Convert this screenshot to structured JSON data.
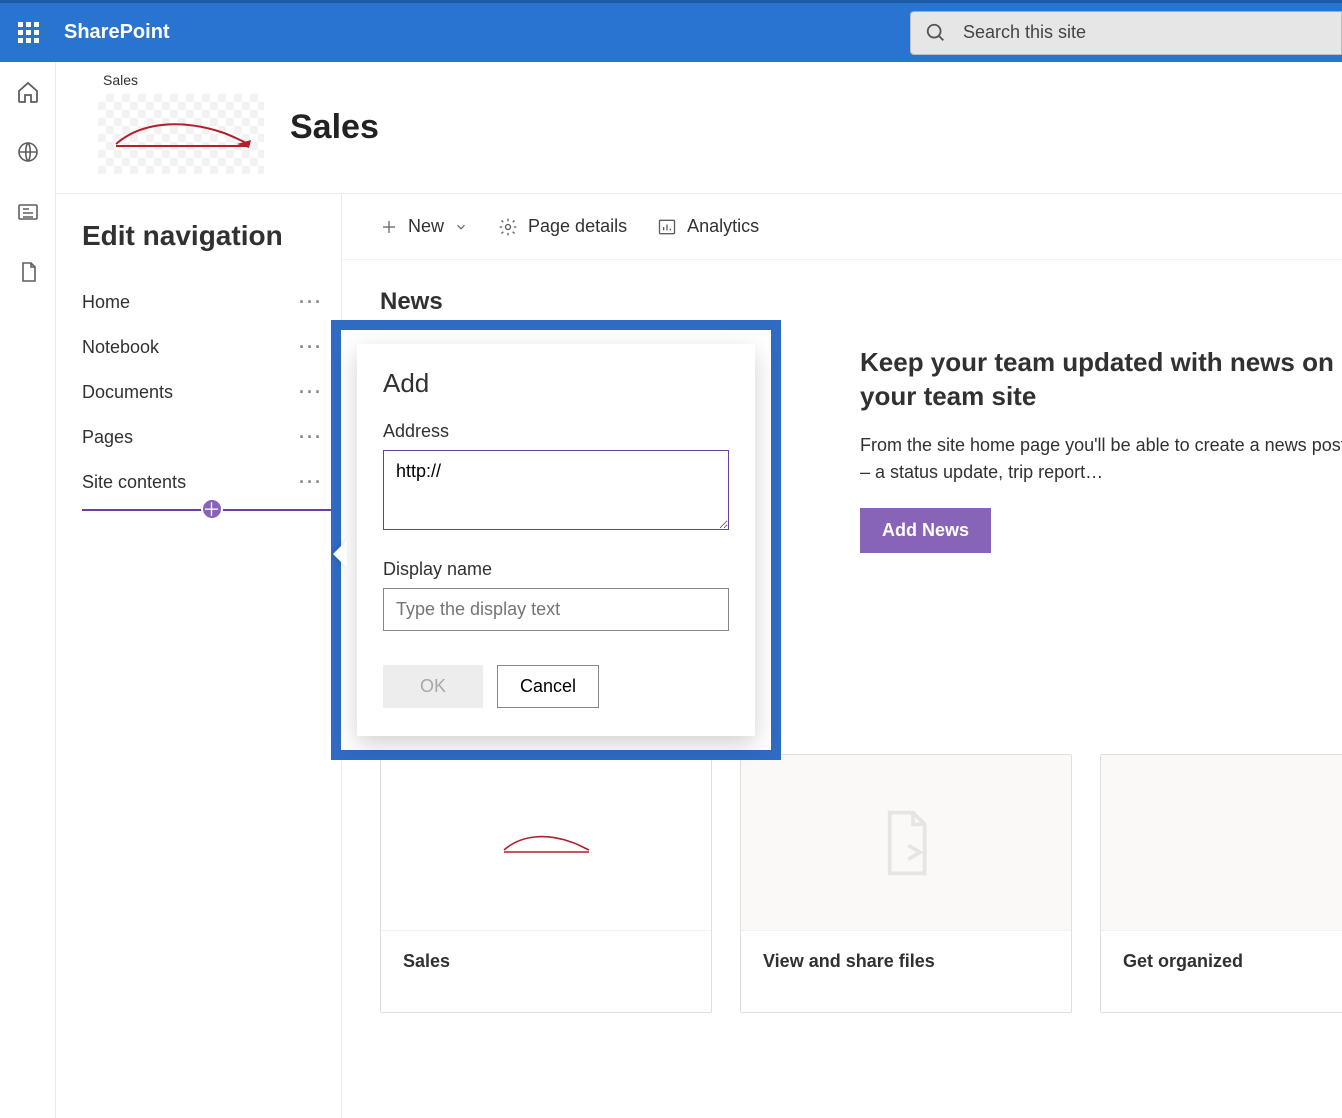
{
  "suite": {
    "brand": "SharePoint",
    "search_placeholder": "Search this site"
  },
  "site": {
    "breadcrumb": "Sales",
    "title": "Sales"
  },
  "leftPanel": {
    "title": "Edit navigation",
    "items": [
      {
        "label": "Home"
      },
      {
        "label": "Notebook"
      },
      {
        "label": "Documents"
      },
      {
        "label": "Pages"
      },
      {
        "label": "Site contents"
      }
    ]
  },
  "cmdBar": {
    "new": "New",
    "pageDetails": "Page details",
    "analytics": "Analytics"
  },
  "news": {
    "section": "News",
    "headline": "Keep your team updated with news on your team site",
    "para": "From the site home page you'll be able to create a news post – a status update, trip report…",
    "addNews": "Add News"
  },
  "cards": [
    {
      "title": "Sales"
    },
    {
      "title": "View and share files"
    },
    {
      "title": "Get organized"
    }
  ],
  "dialog": {
    "title": "Add",
    "addressLabel": "Address",
    "addressValue": "http://",
    "displayLabel": "Display name",
    "displayPlaceholder": "Type the display text",
    "ok": "OK",
    "cancel": "Cancel"
  }
}
